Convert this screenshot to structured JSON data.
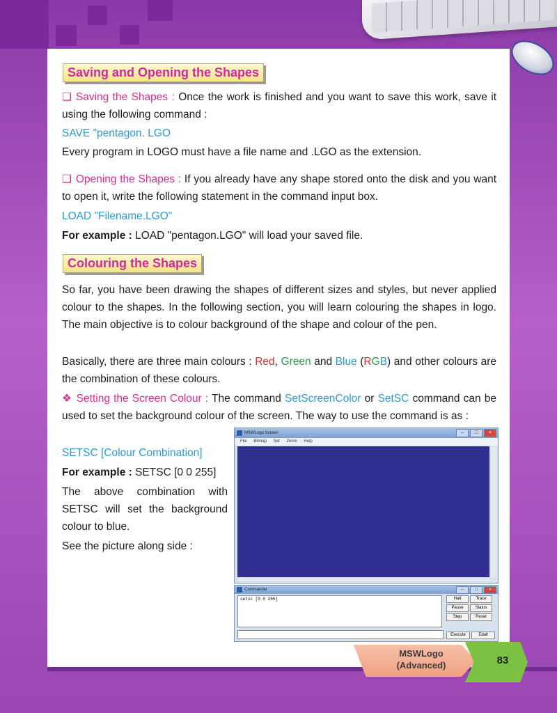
{
  "section1": {
    "heading": "Saving and Opening the Shapes",
    "saving_label": "Saving the Shapes :",
    "saving_text": "Once the work is finished and you want to save this work, save it using the following command :",
    "save_command": "SAVE \"pentagon. LGO",
    "extension_note": "Every program in LOGO must have a file name and .LGO as the extension.",
    "opening_label": "Opening the Shapes :",
    "opening_text": "If you already have any shape stored onto the disk and you want to open it, write the following statement in the command input box.",
    "load_command": "LOAD \"Filename.LGO\"",
    "example_label": "For example :",
    "example_text": "LOAD \"pentagon.LGO\" will load your saved file."
  },
  "section2": {
    "heading": "Colouring the Shapes",
    "intro": "So far, you have been drawing the shapes of different sizes and styles, but never applied colour to the shapes. In the following section, you will learn colouring the shapes in logo. The main objective is to colour background of the shape and colour of the pen.",
    "basic_pre": "Basically, there are three main colours :",
    "red": "Red",
    "green": "Green",
    "and": "and",
    "blue": "Blue",
    "rgb_r": "R",
    "rgb_g": "G",
    "rgb_b": "B",
    "basic_post": "and other colours are the combination of these colours.",
    "screen_label": "Setting the Screen Colour :",
    "screen_text_1": "The command",
    "setscreencolor": "SetScreenColor",
    "or": "or",
    "setsc": "SetSC",
    "screen_text_2": "command can be used to set the background colour of the screen. The way to use the command is as :",
    "setsc_syntax": "SETSC [Colour Combination]",
    "example_label": "For example :",
    "example_text": "SETSC [0 0 255]",
    "explain": "The above combination with SETSC will set the background colour to blue.",
    "see_picture": "See the picture along side :"
  },
  "msw_window": {
    "title": "MSWLogo Screen",
    "menu": [
      "File",
      "Bitmap",
      "Set",
      "Zoom",
      "Help"
    ],
    "canvas_color": "#2e2f8e"
  },
  "commander": {
    "title": "Commander",
    "input_text": "setsc [0 0 255]",
    "buttons": [
      "Halt",
      "Trace",
      "Pause",
      "Status",
      "Step",
      "Reset"
    ],
    "execute": "Execute",
    "edall": "Edall"
  },
  "footer": {
    "book_line1": "MSWLogo",
    "book_line2": "(Advanced)",
    "page_number": "83"
  },
  "colors": {
    "accent_pink": "#e6288e",
    "accent_blue": "#2a9ad8",
    "red": "#e8262a",
    "green": "#23a049",
    "purple_bg": "#9c46b6"
  }
}
